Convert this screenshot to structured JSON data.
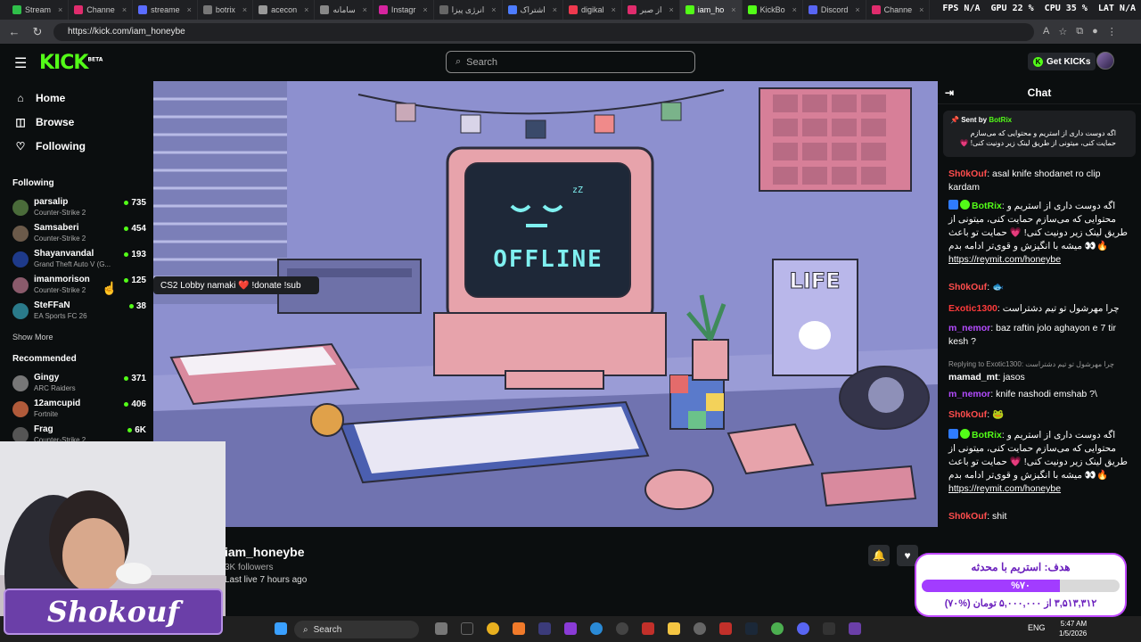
{
  "browser": {
    "tabs": [
      {
        "label": "Stream",
        "color": "#2fbf4a"
      },
      {
        "label": "Channe",
        "color": "#e02c6d"
      },
      {
        "label": "streame",
        "color": "#5a6cff"
      },
      {
        "label": "botrix",
        "color": "#777"
      },
      {
        "label": "acecon",
        "color": "#999"
      },
      {
        "label": "سامانه",
        "color": "#888"
      },
      {
        "label": "Instagr",
        "color": "#d6249f"
      },
      {
        "label": "انرژی پیزا",
        "color": "#666"
      },
      {
        "label": "اشتراک",
        "color": "#4d7cff"
      },
      {
        "label": "digikal",
        "color": "#ef394e"
      },
      {
        "label": "از صبر",
        "color": "#e02c6d"
      },
      {
        "label": "iam_ho",
        "color": "#53fc18",
        "active": true
      },
      {
        "label": "KickBo",
        "color": "#53fc18"
      },
      {
        "label": "Discord",
        "color": "#5865f2"
      },
      {
        "label": "Channe",
        "color": "#e02c6d"
      }
    ],
    "perf": {
      "fps": "FPS N/A",
      "gpu": "GPU 22 %",
      "cpu": "CPU 35 %",
      "lat": "LAT N/A"
    },
    "url": "https://kick.com/iam_honeybe"
  },
  "kick": {
    "logo": "KICK",
    "logo_sup": "BETA",
    "search_placeholder": "Search",
    "get_kicks": "Get KICKs"
  },
  "sidebar": {
    "nav": [
      {
        "label": "Home",
        "icon": "⌂"
      },
      {
        "label": "Browse",
        "icon": "◫"
      },
      {
        "label": "Following",
        "icon": "♡"
      }
    ],
    "following_title": "Following",
    "following": [
      {
        "name": "parsalip",
        "game": "Counter-Strike 2",
        "viewers": "735",
        "color": "#4a6b3a"
      },
      {
        "name": "Samsaberi",
        "game": "Counter-Strike 2",
        "viewers": "454",
        "color": "#6b5a4a"
      },
      {
        "name": "Shayanvandal",
        "game": "Grand Theft Auto V (G...",
        "viewers": "193",
        "color": "#1e3a8a"
      },
      {
        "name": "imanmorison",
        "game": "Counter-Strike 2",
        "viewers": "125",
        "color": "#8a5a6b"
      },
      {
        "name": "SteFFaN",
        "game": "EA Sports FC 26",
        "viewers": "38",
        "color": "#2a7a8a"
      }
    ],
    "show_more": "Show More",
    "recommended_title": "Recommended",
    "recommended": [
      {
        "name": "Gingy",
        "game": "ARC Raiders",
        "viewers": "371",
        "color": "#777"
      },
      {
        "name": "12amcupid",
        "game": "Fortnite",
        "viewers": "406",
        "color": "#b05a3a"
      },
      {
        "name": "Frag",
        "game": "Counter-Strike 2",
        "viewers": "6K",
        "color": "#555"
      }
    ],
    "tooltip": "CS2 Lobby namaki ❤️ !donate !sub"
  },
  "player": {
    "screen_text": "OFFLINE",
    "poster_text": "LIFE",
    "zz": "zZ"
  },
  "channel": {
    "name": "iam_honeybe",
    "followers": "3K followers",
    "last_live": "Last live 7 hours ago"
  },
  "chat": {
    "title": "Chat",
    "pinned": {
      "sent_by": "Sent by",
      "bot": "BotRix",
      "text": "اگه دوست داری از استریم و محتوایی که می‌سازم حمایت کنی، میتونی از طریق لینک زیر دونیت کنی! 💗"
    },
    "messages": [
      {
        "user": "Sh0kOuf",
        "color": "#ff4d4d",
        "text": "asal knife shodanet ro clip kardam"
      },
      {
        "user": "BotRix",
        "color": "#53fc18",
        "text": "اگه دوست داری از استریم و محتوایی که می‌سازم حمایت کنی، میتونی از طریق لینک زیر دونیت کنی! 💗 حمایت تو باعث میشه با انگیزش و قوی‌تر ادامه بدم 👀🔥",
        "link": "https://reymit.com/honeybe"
      },
      {
        "user": "Sh0kOuf",
        "color": "#ff4d4d",
        "text": "🐟"
      },
      {
        "user": "Exotic1300",
        "color": "#ff3b3b",
        "text": "چرا مهرشول تو تیم دشتراست"
      },
      {
        "user": "m_nemor",
        "color": "#b44cff",
        "text": "baz raftin jolo aghayon e 7 tir kesh ?"
      },
      {
        "reply": "Replying to Exotic1300: چرا مهرشول تو تیم دشتراست",
        "user": "mamad_mt",
        "color": "#ffffff",
        "text": "jasos"
      },
      {
        "user": "m_nemor",
        "color": "#b44cff",
        "text": "knife nashodi emshab ?\\"
      },
      {
        "user": "Sh0kOuf",
        "color": "#ff4d4d",
        "text": "🐸"
      },
      {
        "user": "BotRix",
        "color": "#53fc18",
        "text": "اگه دوست داری از استریم و محتوایی که می‌سازم حمایت کنی، میتونی از طریق لینک زیر دونیت کنی! 💗 حمایت تو باعث میشه با انگیزش و قوی‌تر ادامه بدم 👀🔥",
        "link": "https://reymit.com/honeybe"
      },
      {
        "user": "Sh0kOuf",
        "color": "#ff4d4d",
        "text": "shit"
      }
    ]
  },
  "overlay": {
    "streamer_tag": "Shokouf",
    "goal_title": "هدف: استریم با محدثه",
    "goal_pct_label": "%۷۰",
    "goal_fraction": 0.7,
    "goal_amount": "۳,۵۱۳,۳۱۲ از ۵,۰۰۰,۰۰۰ تومان (%۷۰)"
  },
  "taskbar": {
    "search": "Search",
    "lang": "ENG",
    "time": "5:47 AM",
    "date": "1/5/2026"
  }
}
